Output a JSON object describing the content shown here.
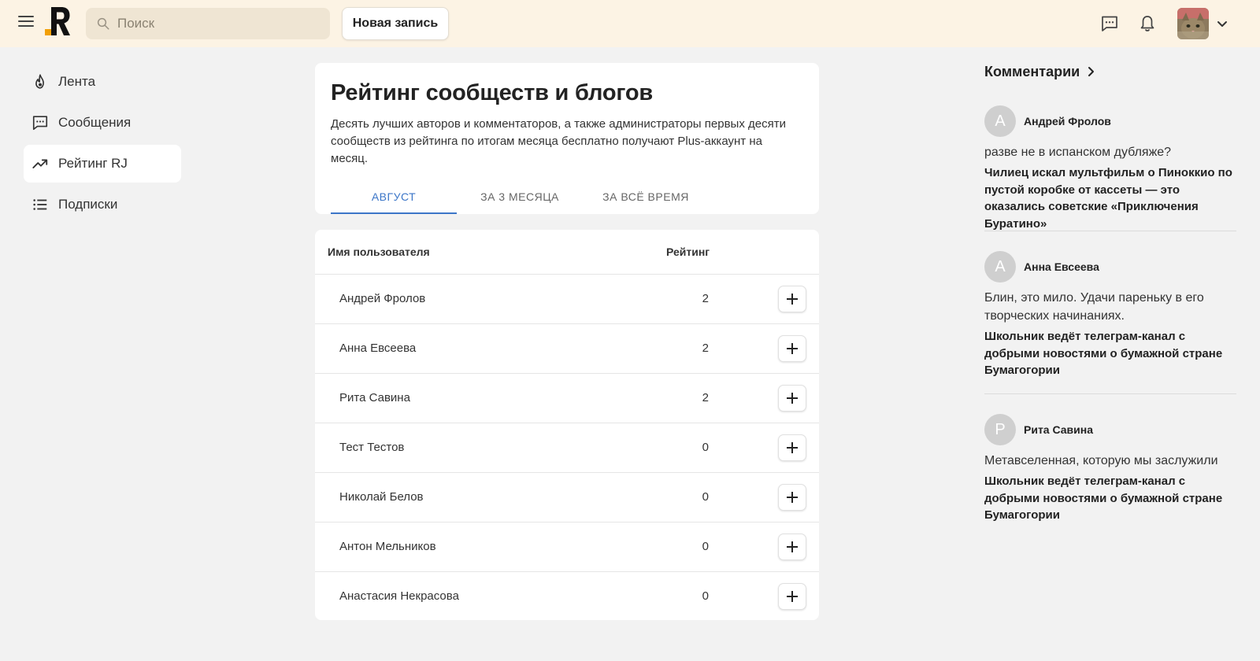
{
  "header": {
    "search_placeholder": "Поиск",
    "new_post_label": "Новая запись",
    "colors": {
      "background": "#fcf3e4",
      "logo": "#111111",
      "logo_accent": "#f2a007"
    }
  },
  "sidebar": {
    "items": [
      {
        "label": "Лента",
        "icon": "fire-icon",
        "active": false
      },
      {
        "label": "Сообщения",
        "icon": "message-icon",
        "active": false
      },
      {
        "label": "Рейтинг RJ",
        "icon": "trending-icon",
        "active": true
      },
      {
        "label": "Подписки",
        "icon": "list-icon",
        "active": false
      }
    ]
  },
  "main": {
    "title": "Рейтинг сообществ и блогов",
    "description": "Десять лучших авторов и комментаторов, а также администраторы первых десяти сообществ из рейтинга по итогам месяца бесплатно получают Plus-аккаунт на месяц.",
    "tabs": [
      {
        "label": "АВГУСТ",
        "active": true
      },
      {
        "label": "ЗА 3 МЕСЯЦА",
        "active": false
      },
      {
        "label": "ЗА ВСЁ ВРЕМЯ",
        "active": false
      }
    ],
    "accent_color": "#3c76c8",
    "table": {
      "headers": {
        "name": "Имя пользователя",
        "rating": "Рейтинг"
      },
      "rows": [
        {
          "name": "Андрей Фролов",
          "rating": "2"
        },
        {
          "name": "Анна Евсеева",
          "rating": "2"
        },
        {
          "name": "Рита Савина",
          "rating": "2"
        },
        {
          "name": "Тест Тестов",
          "rating": "0"
        },
        {
          "name": "Николай Белов",
          "rating": "0"
        },
        {
          "name": "Антон Мельников",
          "rating": "0"
        },
        {
          "name": "Анастасия Некрасова",
          "rating": "0"
        }
      ]
    }
  },
  "comments": {
    "title": "Комментарии",
    "items": [
      {
        "initial": "А",
        "author": "Андрей Фролов",
        "text": "разве не в испанском дубляже?",
        "post": "Чилиец искал мультфильм о Пиноккио по пустой коробке от кассеты — это оказались советские «Приключения Буратино»"
      },
      {
        "initial": "А",
        "author": "Анна Евсеева",
        "text": "Блин, это мило. Удачи пареньку в его творческих начинаниях.",
        "post": "Школьник ведёт телеграм-канал с добрыми новостями о бумажной стране Бумагогории"
      },
      {
        "initial": "Р",
        "author": "Рита Савина",
        "text": "Метавселенная, которую мы заслужили",
        "post": "Школьник ведёт телеграм-канал с добрыми новостями о бумажной стране Бумагогории"
      }
    ]
  }
}
